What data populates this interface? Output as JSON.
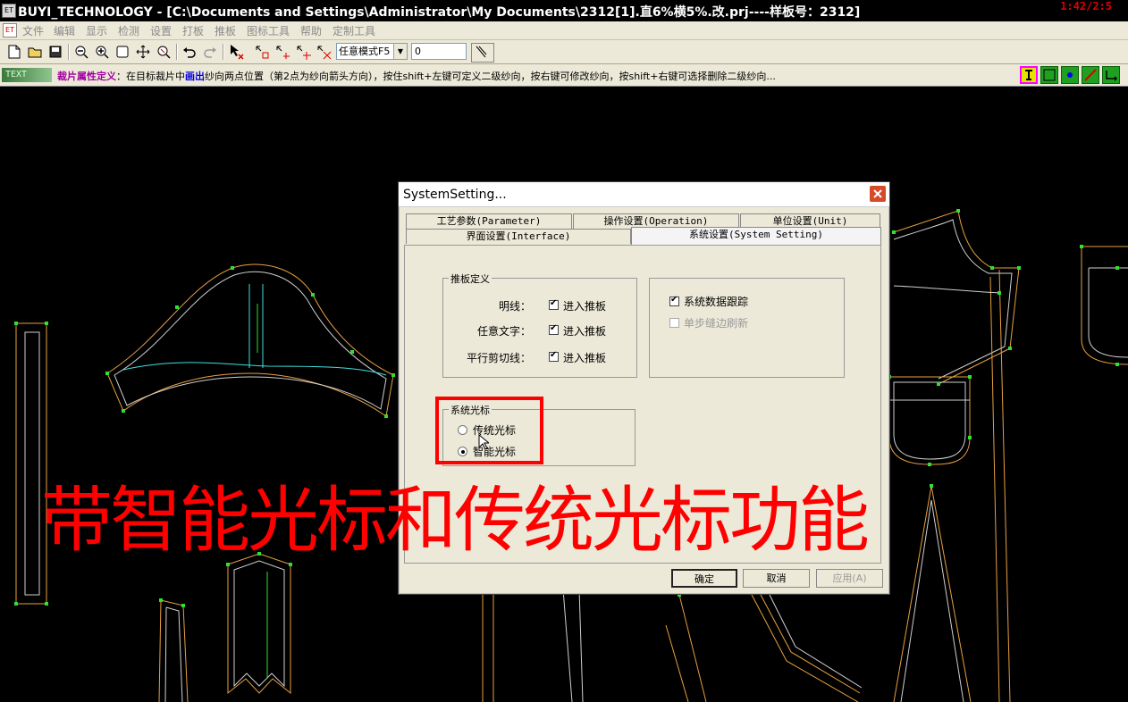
{
  "window": {
    "title": "BUYI_TECHNOLOGY - [C:\\Documents and Settings\\Administrator\\My Documents\\2312[1].直6%横5%.改.prj----样板号：2312]",
    "timer": "1:42/2:5",
    "app_icon": "ET",
    "mdi_icon": "ET"
  },
  "menu": [
    "文件",
    "编辑",
    "显示",
    "检测",
    "设置",
    "打板",
    "推板",
    "图标工具",
    "帮助",
    "定制工具"
  ],
  "toolbar": {
    "mode_select": "任意模式F5",
    "value_input": "0",
    "icons": [
      "new-file-icon",
      "open-folder-icon",
      "save-icon",
      "zoom-out-icon",
      "zoom-in-icon",
      "fit-window-icon",
      "pan-icon",
      "zoom-area-icon",
      "undo-icon",
      "redo-icon",
      "select-delete-icon",
      "grade-point-icon",
      "grade-x-icon",
      "grade-y-icon",
      "grade-clear-icon",
      "pen-icon"
    ]
  },
  "hint": {
    "tag": "TEXT",
    "title": "裁片属性定义",
    "prefix": "：在目标裁片中",
    "emphasis": "画出",
    "body": "纱向两点位置（第2点为纱向箭头方向），按住shift+左键可定义二级纱向，按右键可修改纱向，按shift+右键可选择删除二级纱向..."
  },
  "mode_buttons": [
    "piece-mode",
    "frame-mode",
    "point-mode",
    "line-mode",
    "arrow-mode"
  ],
  "dialog": {
    "title": "SystemSetting...",
    "tabs_row1": [
      "工艺参数(Parameter)",
      "操作设置(Operation)",
      "单位设置(Unit)"
    ],
    "tabs_row2": [
      "界面设置(Interface)",
      "系统设置(System Setting)"
    ],
    "active_tab": "系统设置(System Setting)",
    "grading_group": {
      "legend": "推板定义",
      "rows": [
        {
          "label": "明线：",
          "checkbox": "进入推板",
          "checked": true
        },
        {
          "label": "任意文字：",
          "checkbox": "进入推板",
          "checked": true
        },
        {
          "label": "平行剪切线：",
          "checkbox": "进入推板",
          "checked": true
        }
      ]
    },
    "tracking_group": {
      "items": [
        {
          "label": "系统数据跟踪",
          "checked": true,
          "enabled": true
        },
        {
          "label": "单步缝边刷新",
          "checked": false,
          "enabled": false
        }
      ]
    },
    "cursor_group": {
      "legend": "系统光标",
      "options": [
        {
          "label": "传统光标",
          "selected": false
        },
        {
          "label": "智能光标",
          "selected": true
        }
      ]
    },
    "buttons": {
      "ok": "确定",
      "cancel": "取消",
      "apply": "应用(A)"
    }
  },
  "caption": "带智能光标和传统光标功能",
  "colors": {
    "caption": "#ff0000",
    "highlight_box": "#ff0000",
    "pattern_outer": "#e8a040",
    "pattern_inner": "#d0d0d0",
    "pattern_points": "#30e030",
    "grain_line": "#40e0e0"
  }
}
